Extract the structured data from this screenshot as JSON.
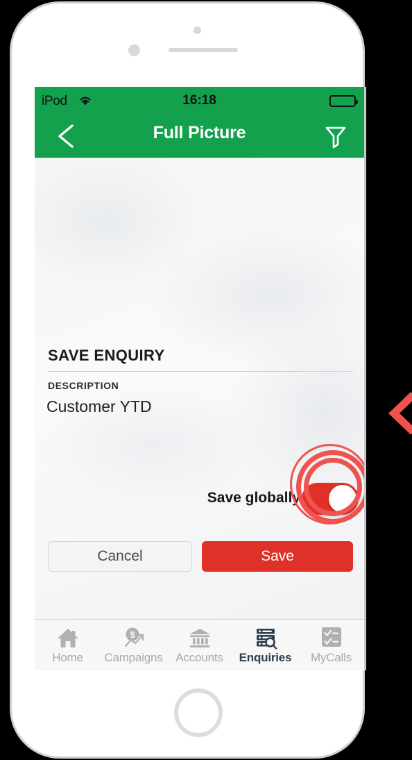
{
  "status_bar": {
    "carrier": "iPod",
    "wifi_icon": "wifi-icon",
    "time": "16:18",
    "battery_icon": "battery-full-icon"
  },
  "nav_bar": {
    "back_icon": "chevron-left-icon",
    "title": "Full Picture",
    "filter_icon": "funnel-filter-icon",
    "background_color": "#13a14e"
  },
  "form": {
    "section_title": "SAVE ENQUIRY",
    "description_label": "DESCRIPTION",
    "description_value": "Customer YTD",
    "save_globally_label": "Save globally",
    "save_globally_state": "on",
    "toggle_color": "#e03129",
    "cancel_label": "Cancel",
    "save_label": "Save",
    "save_button_color": "#e03129"
  },
  "annotation": {
    "tap_highlight": "tap-target-rings",
    "tap_highlight_color": "#ef5350",
    "pointer_icon": "chevron-left-pointer-icon"
  },
  "tab_bar": {
    "items": [
      {
        "label": "Home",
        "icon": "home-icon",
        "active": false
      },
      {
        "label": "Campaigns",
        "icon": "campaigns-dollar-chart-icon",
        "active": false
      },
      {
        "label": "Accounts",
        "icon": "bank-building-icon",
        "active": false
      },
      {
        "label": "Enquiries",
        "icon": "server-search-icon",
        "active": true
      },
      {
        "label": "MyCalls",
        "icon": "checklist-icon",
        "active": false
      }
    ],
    "active_color": "#2c3e50",
    "inactive_color": "#a9a9a9"
  },
  "device": {
    "earpiece": "earpiece-speaker",
    "front_camera": "front-camera",
    "proximity_sensor": "proximity-sensor",
    "home_button": "home-button"
  }
}
